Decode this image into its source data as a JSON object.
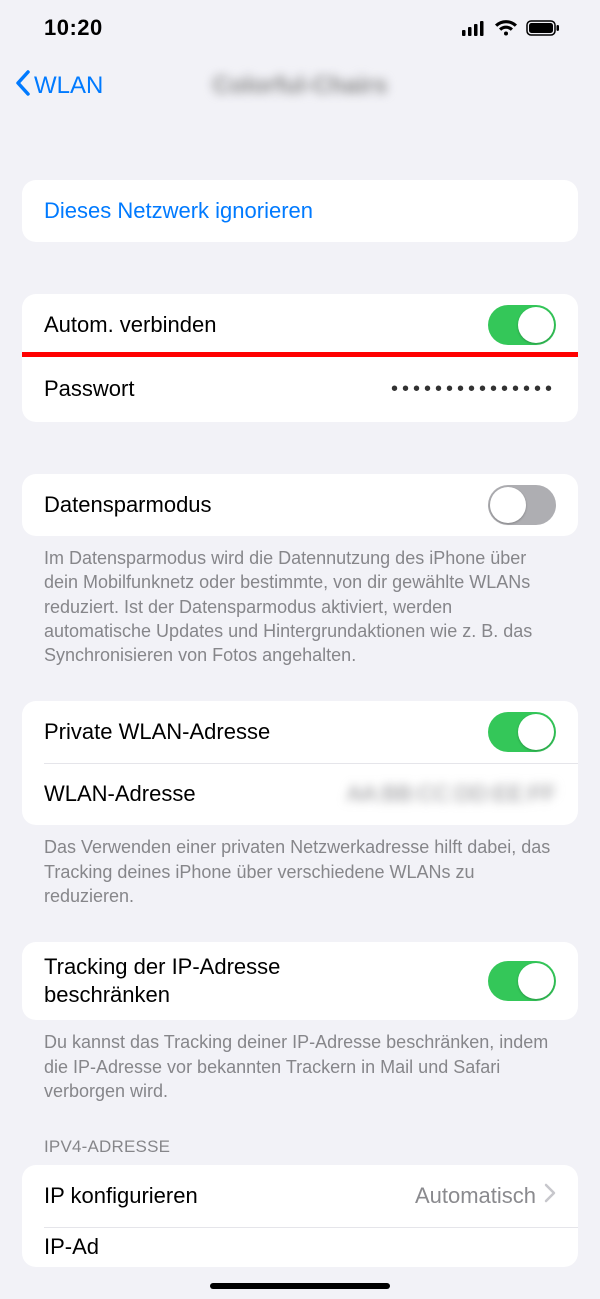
{
  "status": {
    "time": "10:20"
  },
  "nav": {
    "back_label": "WLAN",
    "title": "Colorful-Chairs"
  },
  "group1": {
    "forget": "Dieses Netzwerk ignorieren"
  },
  "group2": {
    "auto_join_label": "Autom. verbinden",
    "auto_join_on": true,
    "password_label": "Passwort",
    "password_dots": "•••••••••••••••"
  },
  "group3": {
    "low_data_label": "Datensparmodus",
    "low_data_on": false,
    "footer": "Im Datensparmodus wird die Datennutzung des iPhone über dein Mobilfunknetz oder bestimmte, von dir gewählte WLANs reduziert. Ist der Datensparmodus aktiviert, werden automatische Updates und Hintergrundaktionen wie z. B. das Synchronisieren von Fotos angehalten."
  },
  "group4": {
    "private_addr_label": "Private WLAN-Adresse",
    "private_addr_on": true,
    "wlan_addr_label": "WLAN-Adresse",
    "wlan_addr_value": "AA:BB:CC:DD:EE:FF",
    "footer": "Das Verwenden einer privaten Netzwerkadresse hilft dabei, das Tracking deines iPhone über verschiedene WLANs zu reduzieren."
  },
  "group5": {
    "limit_ip_label": "Tracking der IP-Adresse beschränken",
    "limit_ip_on": true,
    "footer": "Du kannst das Tracking deiner IP-Adresse beschränken, indem die IP-Adresse vor bekannten Trackern in Mail und Safari verborgen wird."
  },
  "ipv4": {
    "header": "IPV4-ADRESSE",
    "configure_label": "IP konfigurieren",
    "configure_value": "Automatisch",
    "ip_label": "IP-Ad"
  }
}
